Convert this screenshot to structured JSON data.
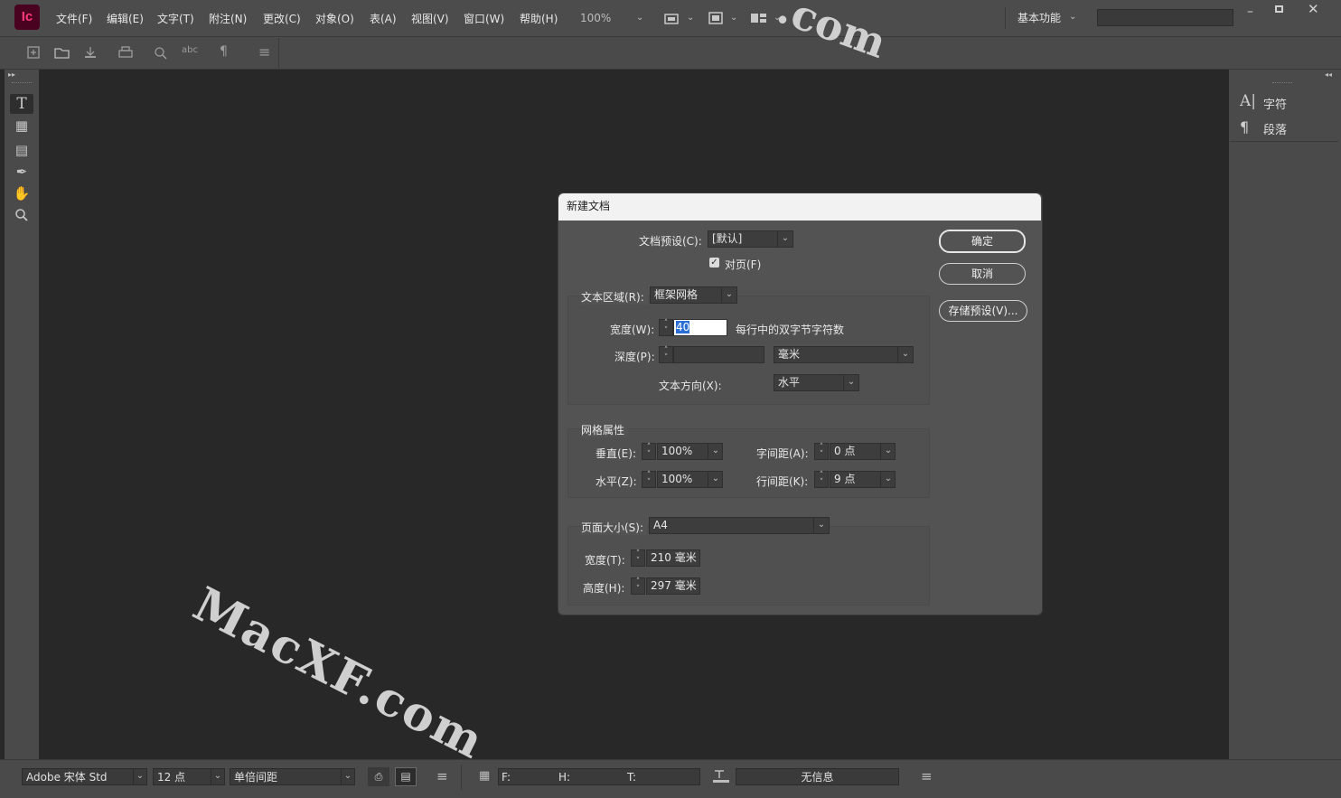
{
  "app": {
    "logo_text": "Ic",
    "zoom": "100%",
    "workspace": "基本功能"
  },
  "menu": [
    "文件(F)",
    "编辑(E)",
    "文字(T)",
    "附注(N)",
    "更改(C)",
    "对象(O)",
    "表(A)",
    "视图(V)",
    "窗口(W)",
    "帮助(H)"
  ],
  "right_panel": {
    "items": [
      {
        "label": "字符",
        "icon": "character-icon"
      },
      {
        "label": "段落",
        "icon": "paragraph-icon"
      }
    ]
  },
  "status": {
    "font_family": "Adobe 宋体 Std",
    "font_size": "12 点",
    "leading": "单倍间距",
    "f_label": "F:",
    "h_label": "H:",
    "t_label": "T:",
    "info": "无信息"
  },
  "dialog": {
    "title": "新建文档",
    "preset_label": "文档预设(C):",
    "preset_value": "[默认]",
    "facing_label": "对页(F)",
    "facing_checked": true,
    "text_area_label": "文本区域(R):",
    "text_area_value": "框架网格",
    "width_label": "宽度(W):",
    "width_value": "40",
    "width_unit_text": "每行中的双字节字符数",
    "depth_label": "深度(P):",
    "depth_value": "",
    "depth_unit": "毫米",
    "direction_label": "文本方向(X):",
    "direction_value": "水平",
    "grid_attrs_label": "网格属性",
    "vertical_label": "垂直(E):",
    "vertical_value": "100%",
    "char_spacing_label": "字间距(A):",
    "char_spacing_value": "0 点",
    "horizontal_label": "水平(Z):",
    "horizontal_value": "100%",
    "line_spacing_label": "行间距(K):",
    "line_spacing_value": "9 点",
    "page_size_label": "页面大小(S):",
    "page_size_value": "A4",
    "page_width_label": "宽度(T):",
    "page_width_value": "210 毫米",
    "page_height_label": "高度(H):",
    "page_height_value": "297 毫米",
    "ok": "确定",
    "cancel": "取消",
    "save_preset": "存储预设(V)..."
  },
  "watermark": {
    "main": "MacXF.com",
    "top": ".com"
  }
}
